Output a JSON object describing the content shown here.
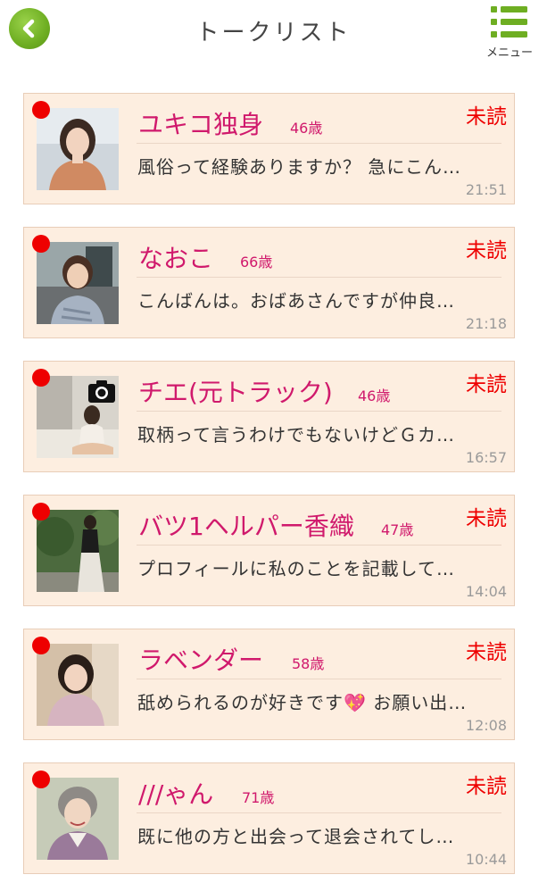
{
  "header": {
    "title": "トークリスト",
    "menu_label": "メニュー",
    "back_icon": "chevron-left-icon",
    "menu_icon": "list-menu-icon",
    "accent_color": "#6eae22"
  },
  "talks": [
    {
      "name": "ユキコ独身",
      "age": "46歳",
      "status": "未読",
      "preview": "風俗って経験ありますか？ 急にこん…",
      "time": "21:51"
    },
    {
      "name": "なおこ",
      "age": "66歳",
      "status": "未読",
      "preview": "こんばんは。おばあさんですが仲良…",
      "time": "21:18"
    },
    {
      "name": "チエ(元トラック)",
      "age": "46歳",
      "status": "未読",
      "preview": "取柄って言うわけでもないけどＧカ…",
      "time": "16:57"
    },
    {
      "name": "バツ1ヘルパー香織",
      "age": "47歳",
      "status": "未読",
      "preview": "プロフィールに私のことを記載して…",
      "time": "14:04"
    },
    {
      "name": "ラベンダー",
      "age": "58歳",
      "status": "未読",
      "preview": "舐められるのが好きです💖 お願い出…",
      "time": "12:08"
    },
    {
      "name": "///ゃん",
      "age": "71歳",
      "status": "未読",
      "preview": "既に他の方と出会って退会されてし…",
      "time": "10:44"
    }
  ],
  "colors": {
    "name": "#d0196c",
    "unread": "#ee0000",
    "card_bg": "#fdeee0",
    "card_border": "#e8cdb8"
  }
}
